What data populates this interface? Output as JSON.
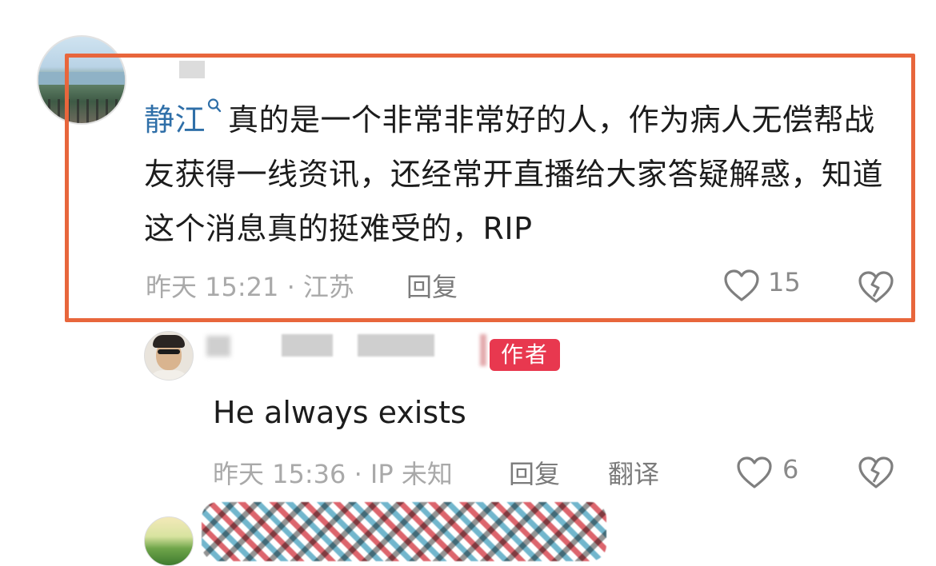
{
  "main_comment": {
    "username": "静江",
    "text": "真的是一个非常非常好的人，作为病人无偿帮战友获得一线资讯，还经常开直播给大家答疑解惑，知道这个消息真的挺难受的，RIP",
    "time_location": "昨天 15:21 · 江苏",
    "reply_label": "回复",
    "like_count": "15",
    "icons": [
      "search-icon",
      "heart-icon",
      "broken-heart-icon"
    ]
  },
  "reply_comment": {
    "author_badge": "作者",
    "text": "He always exists",
    "time_location": "昨天 15:36 · IP 未知",
    "reply_label": "回复",
    "translate_label": "翻译",
    "like_count": "6",
    "icons": [
      "heart-icon",
      "broken-heart-icon"
    ]
  },
  "colors": {
    "highlight_border": "#e8663c",
    "username": "#2f6fa8",
    "author_badge": "#e8384f",
    "meta_text": "#a9a9a9"
  }
}
